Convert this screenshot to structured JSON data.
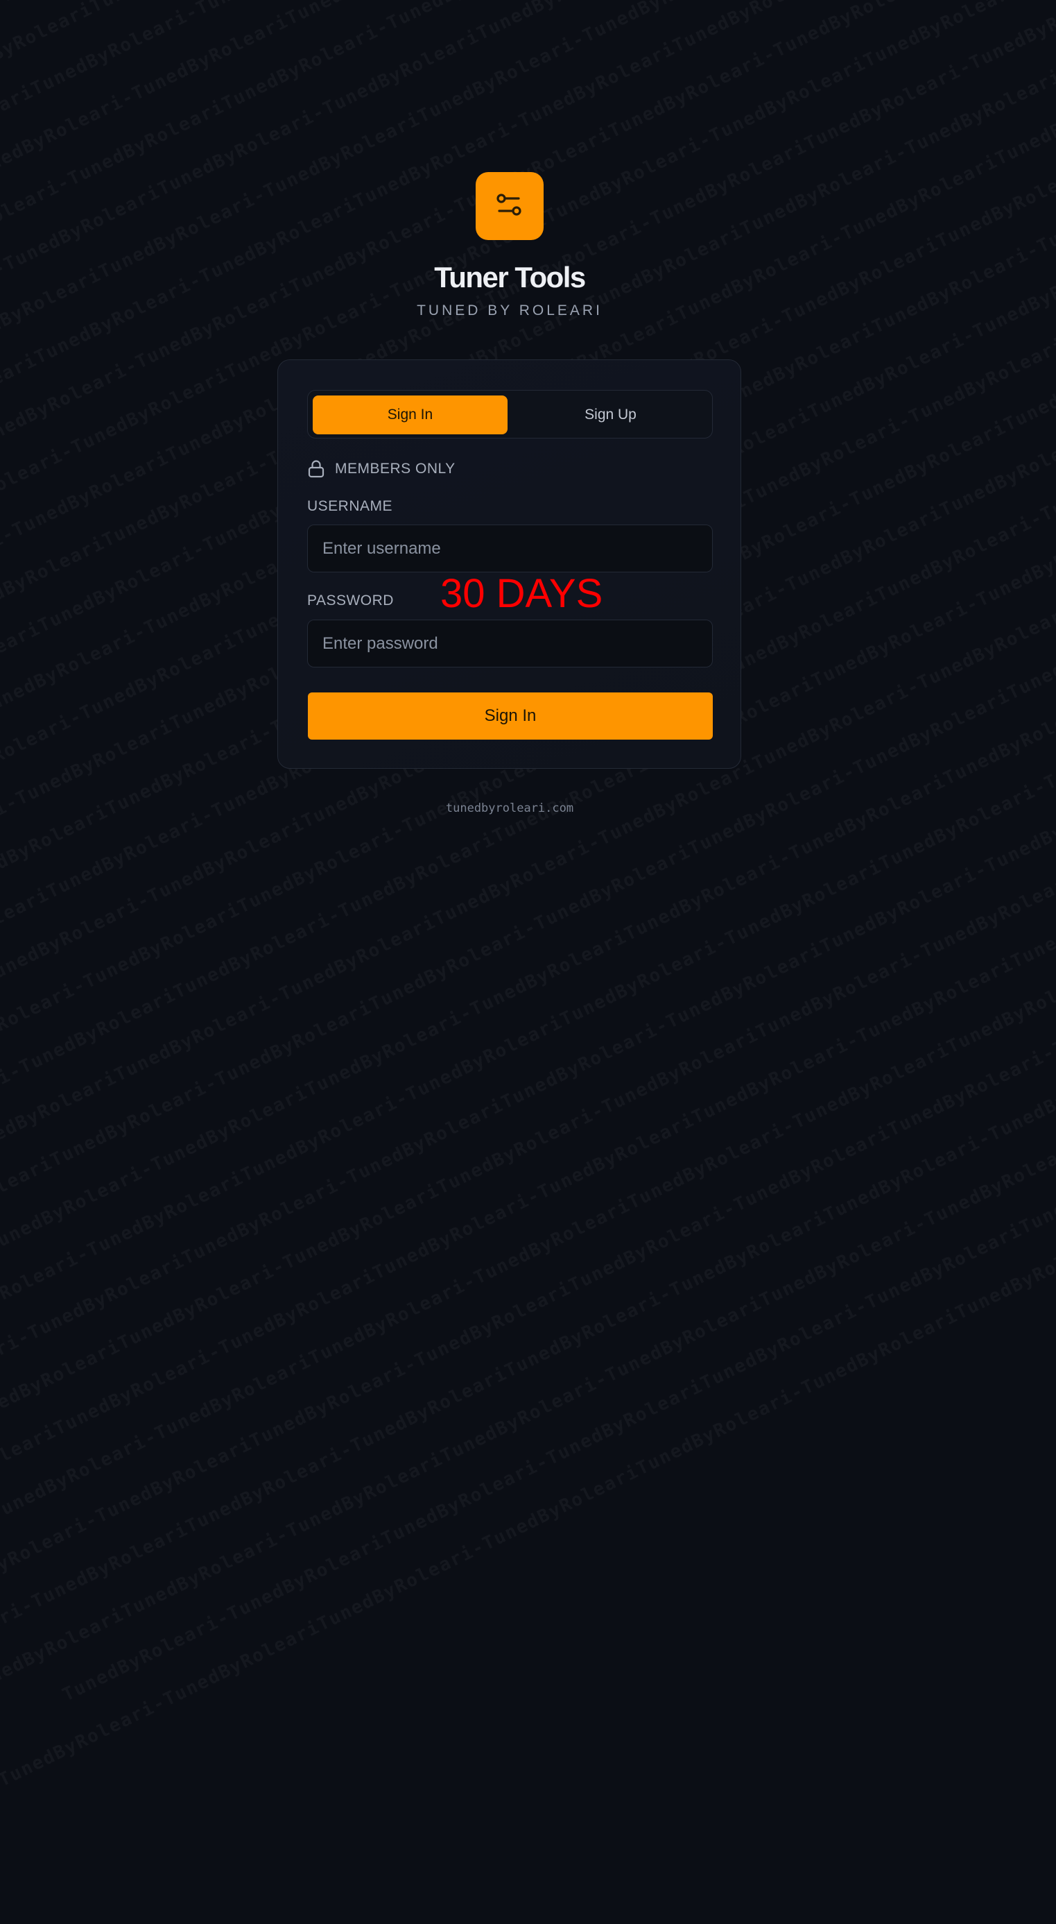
{
  "watermark_text": "TunedByRoleari-TunedByRoleariTunedByRoleari-TunedByRoleariTunedByRoleari-TunedByRoleariTunedByRoleari-TunedByRoleariTunedByRoleari-TunedByRoleariTunedByRoleari-TunedByRoleari",
  "brand": {
    "title": "Tuner Tools",
    "subtitle": "TUNED BY ROLEARI",
    "logo_icon": "sliders-icon",
    "accent_color": "#fe9500"
  },
  "tabs": [
    {
      "label": "Sign In",
      "active": true
    },
    {
      "label": "Sign Up",
      "active": false
    }
  ],
  "notice": {
    "icon": "lock-icon",
    "text": "MEMBERS ONLY"
  },
  "form": {
    "username_label": "USERNAME",
    "username_placeholder": "Enter username",
    "username_value": "",
    "password_label": "PASSWORD",
    "password_placeholder": "Enter password",
    "password_value": "",
    "submit_label": "Sign In"
  },
  "overlay": {
    "text": "30 DAYS",
    "color": "#ff0000"
  },
  "footer": {
    "domain": "tunedbyroleari.com"
  }
}
